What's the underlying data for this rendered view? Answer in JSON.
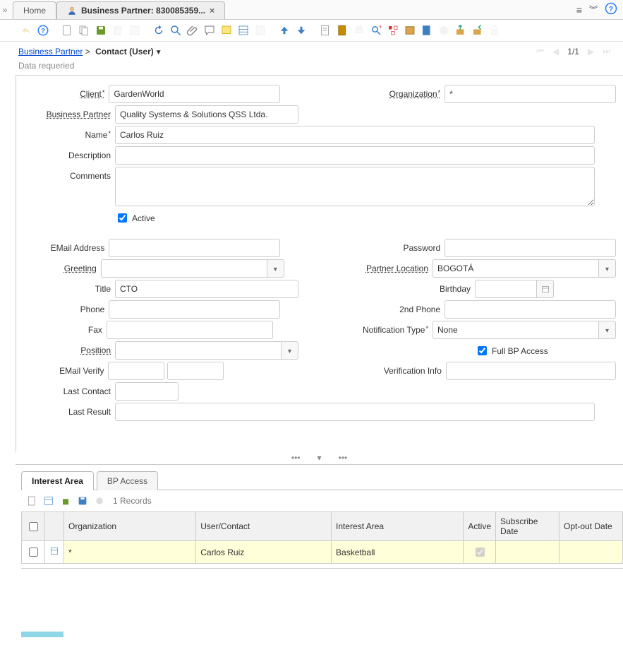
{
  "tabs": {
    "home": "Home",
    "bp": "Business Partner: 830085359..."
  },
  "topright": {
    "menu": "≡",
    "collapse": "¥",
    "help": "?"
  },
  "breadcrumb": {
    "root": "Business Partner",
    "sep": ">",
    "current": "Contact (User)"
  },
  "pager": {
    "text": "1/1"
  },
  "status": "Data requeried",
  "labels": {
    "client": "Client",
    "organization": "Organization",
    "bp": "Business Partner",
    "name": "Name",
    "description": "Description",
    "comments": "Comments",
    "active": "Active",
    "email": "EMail Address",
    "password": "Password",
    "greeting": "Greeting",
    "partnerloc": "Partner Location",
    "title": "Title",
    "birthday": "Birthday",
    "phone": "Phone",
    "phone2": "2nd Phone",
    "fax": "Fax",
    "notiftype": "Notification Type",
    "position": "Position",
    "fullbp": "Full BP Access",
    "emailverify": "EMail Verify",
    "verifinfo": "Verification Info",
    "lastcontact": "Last Contact",
    "lastresult": "Last Result"
  },
  "values": {
    "client": "GardenWorld",
    "organization": "*",
    "bp": "Quality Systems & Solutions QSS Ltda.",
    "name": "Carlos Ruiz",
    "description": "",
    "comments": "",
    "active": true,
    "email": "",
    "password": "",
    "greeting": "",
    "partnerloc": "BOGOTÁ",
    "title": "CTO",
    "birthday": "",
    "phone": "",
    "phone2": "",
    "fax": "",
    "notiftype": "None",
    "position": "",
    "fullbp": true,
    "emailverify": "",
    "verifinfo": "",
    "lastcontact": "",
    "lastresult": ""
  },
  "subtabs": {
    "interest": "Interest Area",
    "bpaccess": "BP Access"
  },
  "records_label": "1 Records",
  "grid": {
    "headers": {
      "org": "Organization",
      "user": "User/Contact",
      "interest": "Interest Area",
      "active": "Active",
      "sub": "Subscribe Date",
      "opt": "Opt-out Date"
    },
    "row": {
      "org": "*",
      "user": "Carlos Ruiz",
      "interest": "Basketball",
      "active": true,
      "sub": "",
      "opt": ""
    }
  }
}
